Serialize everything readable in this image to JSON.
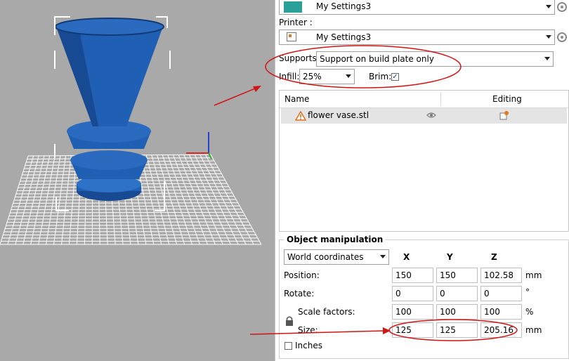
{
  "print_settings": {
    "value": "My Settings3"
  },
  "printer": {
    "label": "Printer :",
    "value": "My Settings3"
  },
  "supports": {
    "label": "Supports:",
    "value": "Support on build plate only"
  },
  "infill": {
    "label": "Infill:",
    "value": "25%"
  },
  "brim": {
    "label": "Brim:",
    "checked": "✓"
  },
  "object_list": {
    "columns": [
      "Name",
      "Editing"
    ],
    "items": [
      {
        "name": "flower vase.stl"
      }
    ]
  },
  "object_manipulation": {
    "title": "Object manipulation",
    "coordinate_system": "World coordinates",
    "axes": [
      "X",
      "Y",
      "Z"
    ],
    "position": {
      "label": "Position:",
      "x": "150",
      "y": "150",
      "z": "102.58",
      "unit": "mm"
    },
    "rotate": {
      "label": "Rotate:",
      "x": "0",
      "y": "0",
      "z": "0",
      "unit": "°"
    },
    "scale": {
      "label": "Scale factors:",
      "x": "100",
      "y": "100",
      "z": "100",
      "unit": "%"
    },
    "size": {
      "label": "Size:",
      "x": "125",
      "y": "125",
      "z": "205.16",
      "unit": "mm"
    },
    "inches": {
      "label": "Inches"
    }
  },
  "colors": {
    "viewport_bg": "#a9a9a9",
    "model": "#1f5fb4",
    "annotation": "#d21414",
    "filament_swatch": "#2aa198"
  }
}
